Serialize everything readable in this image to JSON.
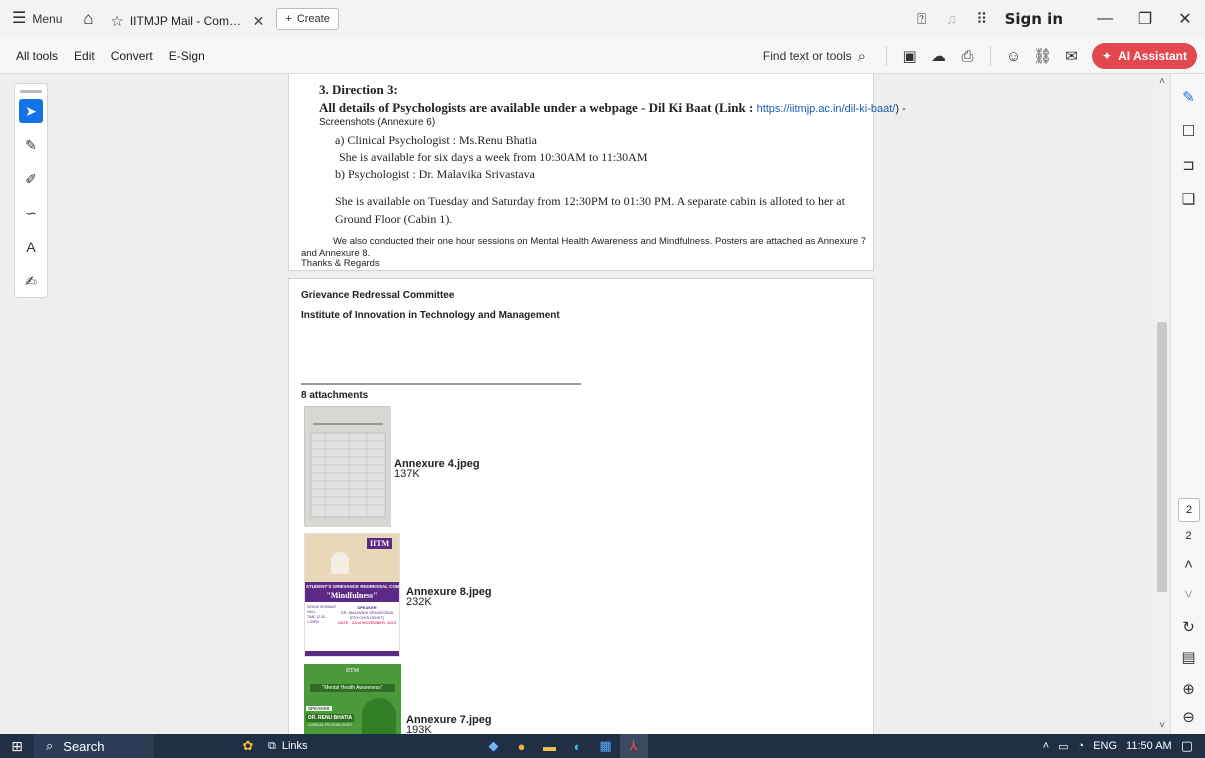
{
  "titlebar": {
    "menu_label": "Menu",
    "tab_title": "IITMJP Mail - Complianc...",
    "create_label": "Create",
    "signin_label": "Sign in"
  },
  "toolbar": {
    "menus": [
      "All tools",
      "Edit",
      "Convert",
      "E-Sign"
    ],
    "find_label": "Find text or tools",
    "ai_label": "AI Assistant"
  },
  "document": {
    "page1": {
      "direction_heading": "3.  Direction 3:",
      "details_line": "All details of Psychologists are available under a webpage - Dil Ki Baat (Link :",
      "link_text": "https://iitmjp.ac.in/dil-ki-baat/",
      "link_suffix": ") -",
      "screenshots_line": "Screenshots (Annexure 6)",
      "item_a": "a)   Clinical Psychologist : Ms.Renu Bhatia",
      "item_a_detail": "She is available for six days a week from 10:30AM to 11:30AM",
      "item_b": "b)   Psychologist : Dr. Malavika Srivastava",
      "item_b_detail_1": "She is available on Tuesday and Saturday from 12:30PM to 01:30 PM. A separate cabin is alloted to her at",
      "item_b_detail_2": "Ground Floor (Cabin 1).",
      "sessions_line_1": "We also conducted their one hour sessions on Mental Health Awareness and Mindfulness. Posters are attached as Annexure 7",
      "sessions_line_2": "and Annexure 8.",
      "thanks": "Thanks & Regards"
    },
    "page2": {
      "committee": "Grievance Redressal Committee",
      "institute": "Institute of Innovation in Technology and Management",
      "attachments_heading": "8 attachments",
      "attachments": [
        {
          "name": "Annexure 4.jpeg",
          "size": "137K"
        },
        {
          "name": "Annexure 8.jpeg",
          "size": "232K"
        },
        {
          "name": "Annexure 7.jpeg",
          "size": "193K"
        }
      ],
      "poster8": {
        "logo": "IITM",
        "banner": "STUDENT'S GRIEVANCE REDRESSAL COMMITTEE",
        "topic": "\"Mindfulness\"",
        "venue_label": "VENUE SEMINAR HALL",
        "time_label": "TIME 12:30 - 1:30PM",
        "speaker_label": "SPEAKER",
        "speaker_name": "DR. MALAVIKA SRIVASTAVA (PSYCHOLOGIST)",
        "date_label": "DATE - 22nd NOVEMBER, 2023"
      },
      "poster7": {
        "logo": "IITM",
        "topic": "\"Mental Health Awareness\"",
        "speaker_label": "SPEAKER",
        "speaker_name": "DR. RENU BHATIA",
        "speaker_role": "CLINICAL PSYCHOLOGIST"
      }
    }
  },
  "right_rail": {
    "current_page": "2",
    "total_pages": "2"
  },
  "taskbar": {
    "search_label": "Search",
    "links_label": "Links",
    "language": "ENG",
    "time": "11:50 AM"
  },
  "colors": {
    "accent": "#1473e6",
    "ai_button": "#e34850",
    "taskbar": "#1f2f44",
    "link": "#1a5fb4"
  }
}
